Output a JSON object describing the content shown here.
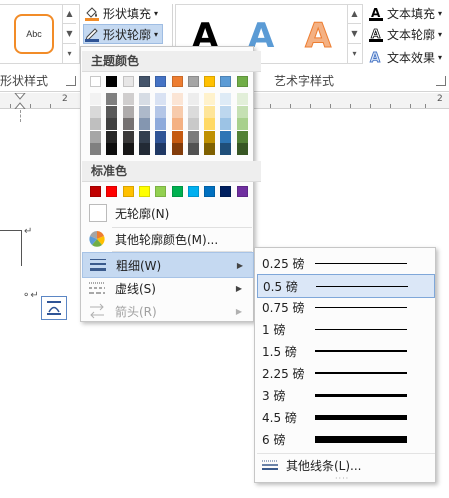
{
  "ribbon": {
    "style_preview_label": "Abc",
    "fill_button_label": "形状填充",
    "outline_button_label": "形状轮廓",
    "group_shape_styles": "形状样式",
    "group_wordart": "艺术字样式",
    "wordart_samples": [
      "A",
      "A",
      "A"
    ],
    "text_fill_label": "文本填充",
    "text_outline_label": "文本轮廓",
    "text_effect_label": "文本效果",
    "ruler_numbers": [
      "2",
      "2"
    ]
  },
  "menu": {
    "theme_colors_header": "主题颜色",
    "standard_colors_header": "标准色",
    "no_outline_label": "无轮廓(N)",
    "more_colors_label": "其他轮廓颜色(M)...",
    "weight_label": "粗细(W)",
    "dashes_label": "虚线(S)",
    "arrows_label": "箭头(R)",
    "theme_top_row": [
      "#ffffff",
      "#000000",
      "#e7e6e6",
      "#44546a",
      "#4472c4",
      "#ed7d31",
      "#a5a5a5",
      "#ffc000",
      "#5b9bd5",
      "#70ad47"
    ],
    "theme_columns": [
      [
        "#f2f2f2",
        "#d9d9d9",
        "#bfbfbf",
        "#a6a6a6",
        "#808080"
      ],
      [
        "#7f7f7f",
        "#595959",
        "#404040",
        "#262626",
        "#0d0d0d"
      ],
      [
        "#d0cece",
        "#aeabab",
        "#757171",
        "#3a3838",
        "#171616"
      ],
      [
        "#d6dce4",
        "#adb9ca",
        "#8496b0",
        "#333f4f",
        "#222a35"
      ],
      [
        "#d9e2f3",
        "#b4c6e7",
        "#8eaadb",
        "#2f5496",
        "#1f3864"
      ],
      [
        "#fbe5d5",
        "#f7cbac",
        "#f4b183",
        "#c55a11",
        "#833c0b"
      ],
      [
        "#ededed",
        "#dbdbdb",
        "#c9c9c9",
        "#7b7b7b",
        "#525252"
      ],
      [
        "#fff2cc",
        "#fee599",
        "#ffd965",
        "#bf9000",
        "#7f6000"
      ],
      [
        "#deebf6",
        "#bdd7ee",
        "#9cc3e5",
        "#2e75b5",
        "#1f4e79"
      ],
      [
        "#e2efd9",
        "#c5e0b3",
        "#a8d08d",
        "#538135",
        "#375623"
      ]
    ],
    "standard_colors": [
      "#c00000",
      "#ff0000",
      "#ffc000",
      "#ffff00",
      "#92d050",
      "#00b050",
      "#00b0f0",
      "#0070c0",
      "#002060",
      "#7030a0"
    ]
  },
  "submenu": {
    "weights": [
      {
        "label": "0.25 磅",
        "pt": 0.25
      },
      {
        "label": "0.5 磅",
        "pt": 0.5
      },
      {
        "label": "0.75 磅",
        "pt": 0.75
      },
      {
        "label": "1 磅",
        "pt": 1
      },
      {
        "label": "1.5 磅",
        "pt": 1.5
      },
      {
        "label": "2.25 磅",
        "pt": 2.25
      },
      {
        "label": "3 磅",
        "pt": 3
      },
      {
        "label": "4.5 磅",
        "pt": 4.5
      },
      {
        "label": "6 磅",
        "pt": 6
      }
    ],
    "selected_weight": "0.5 磅",
    "more_lines_label": "其他线条(L)..."
  }
}
